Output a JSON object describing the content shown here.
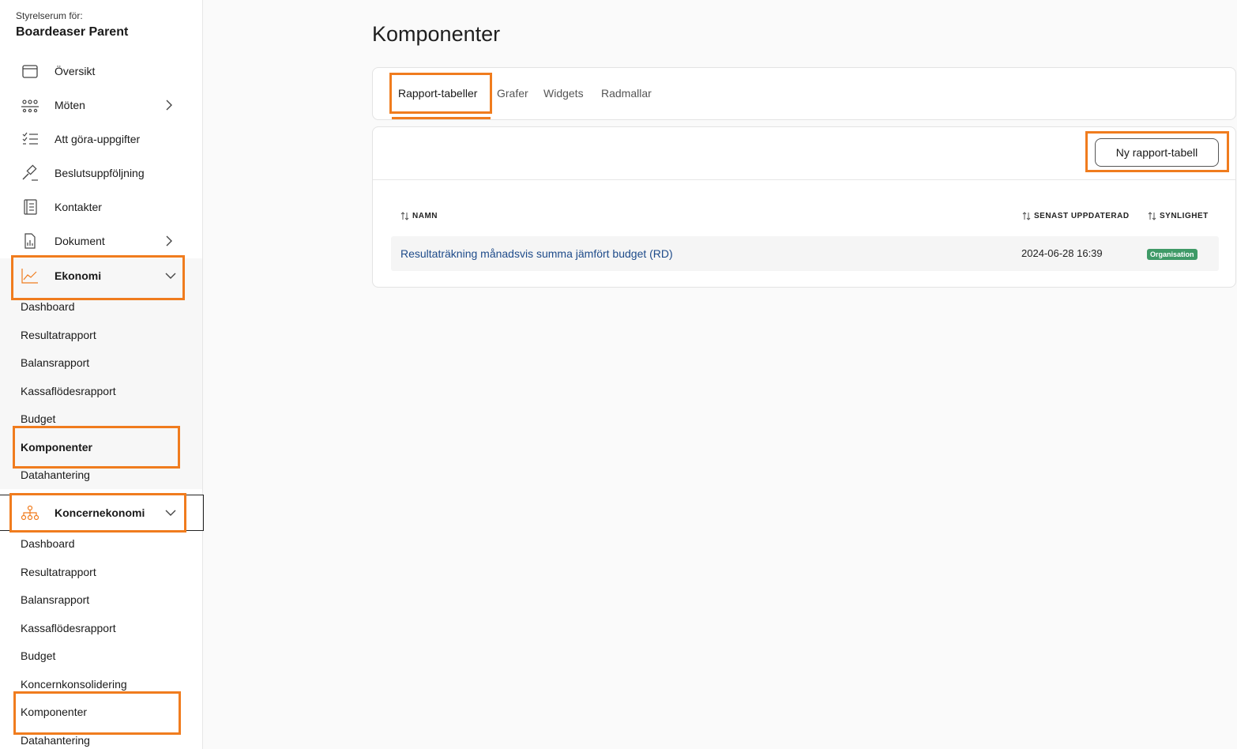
{
  "sidebar": {
    "org_caption": "Styrelserum för:",
    "org_name": "Boardeaser Parent",
    "items": [
      {
        "label": "Översikt",
        "icon": "calendar-window-icon"
      },
      {
        "label": "Möten",
        "icon": "meeting-people-icon"
      },
      {
        "label": "Att göra-uppgifter",
        "icon": "checklist-icon"
      },
      {
        "label": "Beslutsuppföljning",
        "icon": "gavel-icon"
      },
      {
        "label": "Kontakter",
        "icon": "address-book-icon"
      },
      {
        "label": "Dokument",
        "icon": "document-chart-icon"
      },
      {
        "label": "Ekonomi",
        "icon": "line-chart-icon"
      },
      {
        "label": "Koncernekonomi",
        "icon": "org-structure-icon"
      }
    ],
    "ekonomi_sub": [
      "Dashboard",
      "Resultatrapport",
      "Balansrapport",
      "Kassaflödesrapport",
      "Budget",
      "Komponenter",
      "Datahantering"
    ],
    "koncern_sub": [
      "Dashboard",
      "Resultatrapport",
      "Balansrapport",
      "Kassaflödesrapport",
      "Budget",
      "Koncernkonsolidering",
      "Komponenter",
      "Datahantering"
    ]
  },
  "main": {
    "title": "Komponenter",
    "tabs": [
      {
        "label": "Rapport-tabeller",
        "active": true
      },
      {
        "label": "Grafer",
        "active": false
      },
      {
        "label": "Widgets",
        "active": false
      },
      {
        "label": "Radmallar",
        "active": false
      }
    ],
    "new_button": "Ny rapport-tabell",
    "columns": {
      "name": "NAMN",
      "updated": "SENAST UPPDATERAD",
      "visibility": "SYNLIGHET"
    },
    "rows": [
      {
        "name": "Resultaträkning månadsvis summa jämfört budget (RD)",
        "updated": "2024-06-28 16:39",
        "visibility": "Organisation"
      }
    ]
  },
  "colors": {
    "accent": "#f07c1e",
    "link": "#1e4b8a",
    "badge": "#3f9a67"
  }
}
